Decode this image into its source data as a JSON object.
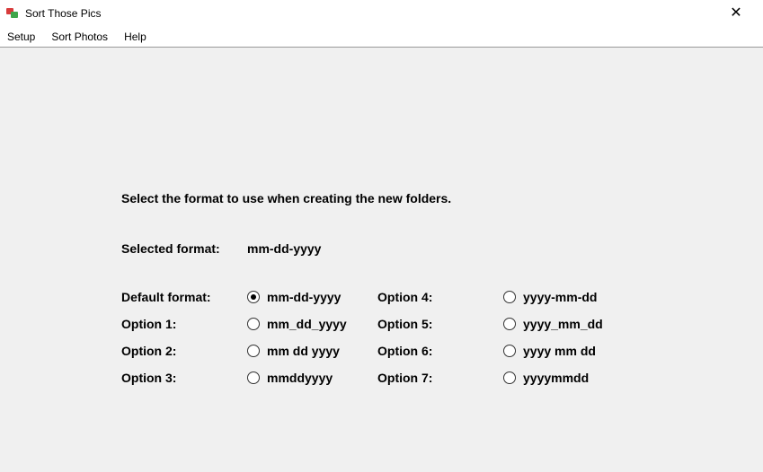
{
  "window": {
    "title": "Sort Those Pics"
  },
  "menu": {
    "setup": "Setup",
    "sort_photos": "Sort Photos",
    "help": "Help"
  },
  "instruction": "Select the format to use when creating the new folders.",
  "selected_format_label": "Selected format:",
  "selected_format_value": "mm-dd-yyyy",
  "labels": {
    "default": "Default format:",
    "opt1": "Option 1:",
    "opt2": "Option 2:",
    "opt3": "Option 3:",
    "opt4": "Option 4:",
    "opt5": "Option 5:",
    "opt6": "Option 6:",
    "opt7": "Option 7:"
  },
  "options": {
    "default": "mm-dd-yyyy",
    "opt1": "mm_dd_yyyy",
    "opt2": "mm dd yyyy",
    "opt3": "mmddyyyy",
    "opt4": "yyyy-mm-dd",
    "opt5": "yyyy_mm_dd",
    "opt6": "yyyy mm dd",
    "opt7": "yyyymmdd"
  },
  "selected_option": "default"
}
